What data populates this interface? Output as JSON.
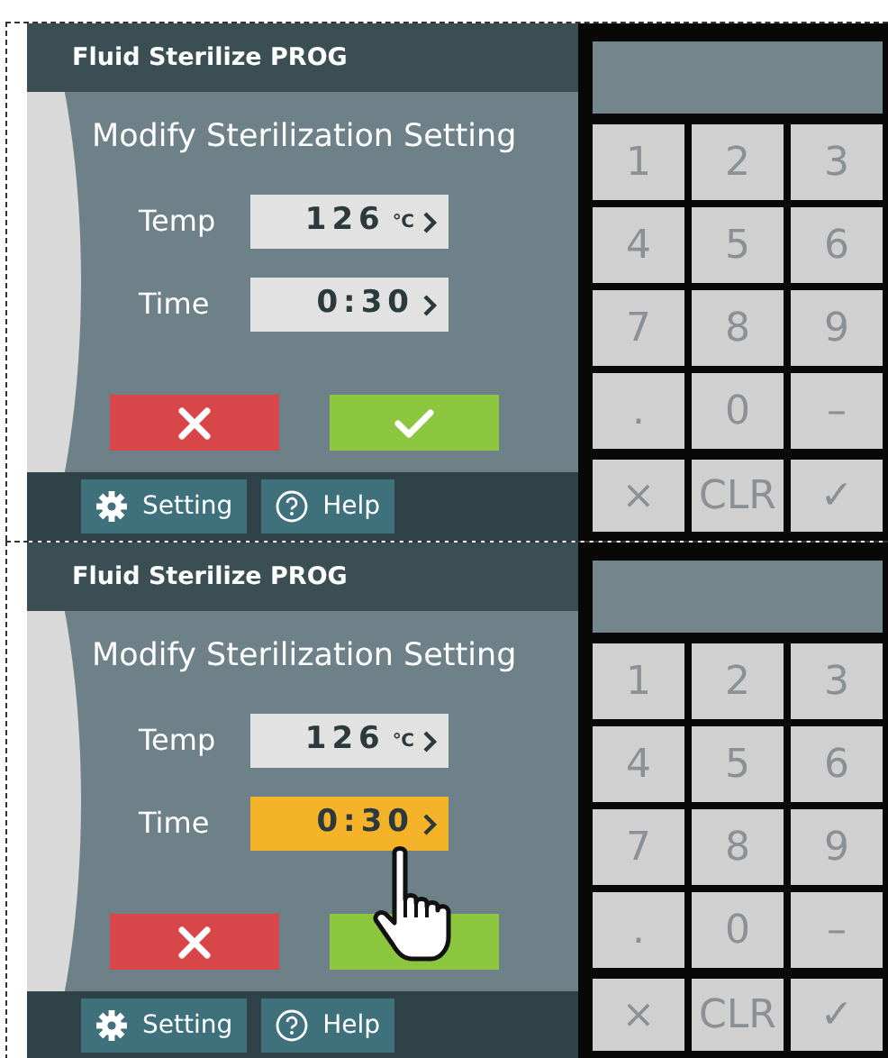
{
  "panels": [
    {
      "title": "Fluid Sterilize PROG",
      "heading": "Modify Sterilization Setting",
      "fields": [
        {
          "label": "Temp",
          "value": "126",
          "unit": "℃",
          "selected": false
        },
        {
          "label": "Time",
          "value": "0:30",
          "selected": false
        }
      ],
      "actions": [
        {
          "kind": "cancel"
        },
        {
          "kind": "confirm"
        }
      ],
      "footer": [
        {
          "kind": "settings",
          "label": "Setting"
        },
        {
          "kind": "help",
          "label": "Help"
        }
      ],
      "pointer": false,
      "keypad": [
        {
          "label": "1",
          "disabled": true
        },
        {
          "label": "2",
          "disabled": true
        },
        {
          "label": "3",
          "disabled": true
        },
        {
          "label": "4",
          "disabled": true
        },
        {
          "label": "5",
          "disabled": true
        },
        {
          "label": "6",
          "disabled": true
        },
        {
          "label": "7",
          "disabled": true
        },
        {
          "label": "8",
          "disabled": true
        },
        {
          "label": "9",
          "disabled": true
        },
        {
          "label": ".",
          "disabled": true
        },
        {
          "label": "0",
          "disabled": true
        },
        {
          "label": "–",
          "disabled": true
        },
        {
          "label": "×",
          "disabled": true
        },
        {
          "label": "CLR",
          "disabled": true
        },
        {
          "label": "✓",
          "disabled": true
        }
      ]
    },
    {
      "title": "Fluid Sterilize PROG",
      "heading": "Modify Sterilization Setting",
      "fields": [
        {
          "label": "Temp",
          "value": "126",
          "unit": "℃",
          "selected": false
        },
        {
          "label": "Time",
          "value": "0:30",
          "selected": true
        }
      ],
      "actions": [
        {
          "kind": "cancel"
        },
        {
          "kind": "confirm"
        }
      ],
      "footer": [
        {
          "kind": "settings",
          "label": "Setting"
        },
        {
          "kind": "help",
          "label": "Help"
        }
      ],
      "pointer": true,
      "keypad": [
        {
          "label": "1",
          "disabled": true
        },
        {
          "label": "2",
          "disabled": true
        },
        {
          "label": "3",
          "disabled": true
        },
        {
          "label": "4",
          "disabled": true
        },
        {
          "label": "5",
          "disabled": true
        },
        {
          "label": "6",
          "disabled": true
        },
        {
          "label": "7",
          "disabled": true
        },
        {
          "label": "8",
          "disabled": true
        },
        {
          "label": "9",
          "disabled": true
        },
        {
          "label": ".",
          "disabled": true
        },
        {
          "label": "0",
          "disabled": true
        },
        {
          "label": "–",
          "disabled": true
        },
        {
          "label": "×",
          "disabled": true
        },
        {
          "label": "CLR",
          "disabled": true
        },
        {
          "label": "✓",
          "disabled": true
        }
      ]
    }
  ]
}
